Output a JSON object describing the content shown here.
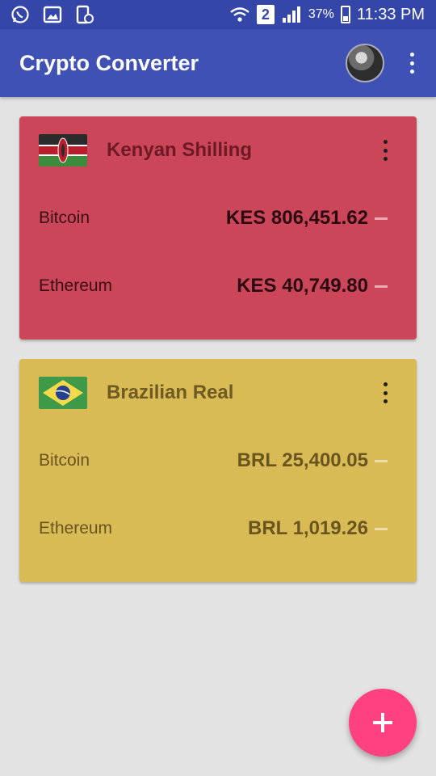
{
  "status_bar": {
    "sim": "2",
    "battery_percent": "37%",
    "time": "11:33 PM",
    "icons": [
      "whatsapp-icon",
      "gallery-icon",
      "screenshot-icon",
      "wifi-icon",
      "signal-icon",
      "battery-icon"
    ]
  },
  "app_bar": {
    "title": "Crypto Converter",
    "icons": [
      "avatar",
      "more-vert-icon"
    ]
  },
  "cards": [
    {
      "currency": "Kenyan Shilling",
      "flag": "kenya-flag-icon",
      "color": "#cc4659",
      "rates": [
        {
          "coin": "Bitcoin",
          "value": "KES 806,451.62"
        },
        {
          "coin": "Ethereum",
          "value": "KES 40,749.80"
        }
      ]
    },
    {
      "currency": "Brazilian Real",
      "flag": "brazil-flag-icon",
      "color": "#d8bb55",
      "rates": [
        {
          "coin": "Bitcoin",
          "value": "BRL 25,400.05"
        },
        {
          "coin": "Ethereum",
          "value": "BRL 1,019.26"
        }
      ]
    }
  ],
  "fab": {
    "icon": "plus-icon",
    "color": "#ff4081"
  }
}
